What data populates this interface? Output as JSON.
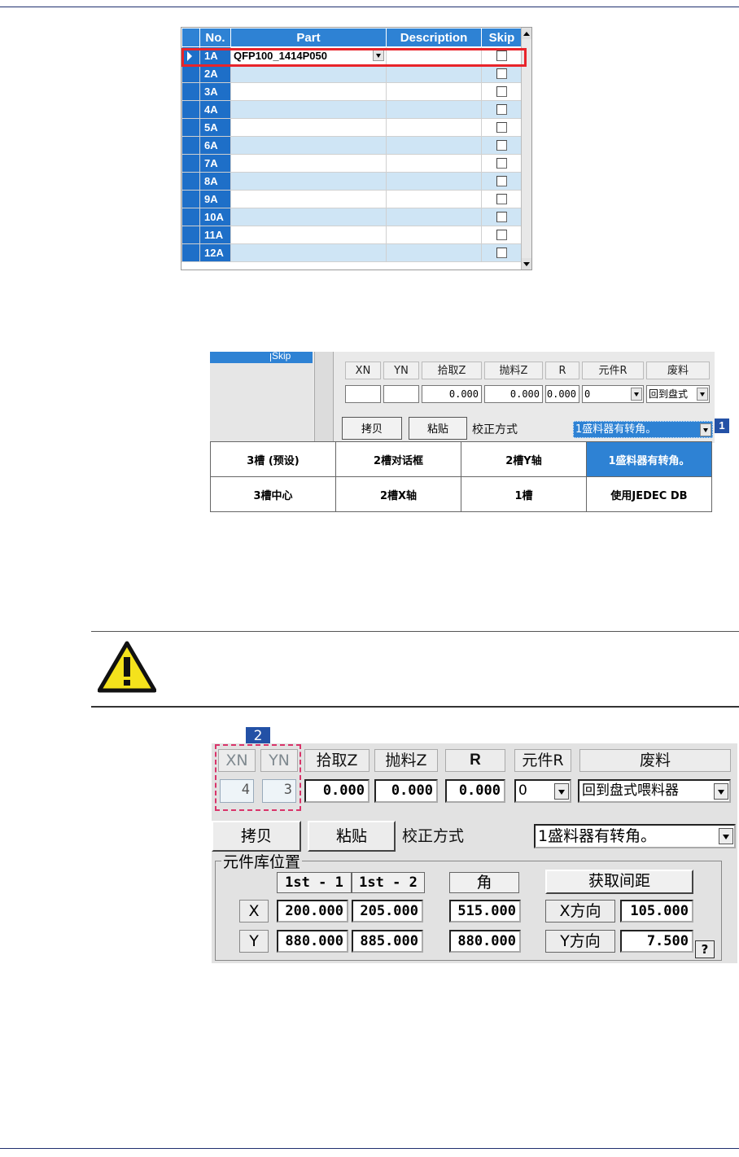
{
  "grid": {
    "headers": {
      "no": "No.",
      "part": "Part",
      "description": "Description",
      "skip": "Skip"
    },
    "rows": [
      {
        "no": "1A",
        "part": "QFP100_1414P050",
        "description": "",
        "skip": false
      },
      {
        "no": "2A",
        "part": "",
        "description": "",
        "skip": false
      },
      {
        "no": "3A",
        "part": "",
        "description": "",
        "skip": false
      },
      {
        "no": "4A",
        "part": "",
        "description": "",
        "skip": false
      },
      {
        "no": "5A",
        "part": "",
        "description": "",
        "skip": false
      },
      {
        "no": "6A",
        "part": "",
        "description": "",
        "skip": false
      },
      {
        "no": "7A",
        "part": "",
        "description": "",
        "skip": false
      },
      {
        "no": "8A",
        "part": "",
        "description": "",
        "skip": false
      },
      {
        "no": "9A",
        "part": "",
        "description": "",
        "skip": false
      },
      {
        "no": "10A",
        "part": "",
        "description": "",
        "skip": false
      },
      {
        "no": "11A",
        "part": "",
        "description": "",
        "skip": false
      },
      {
        "no": "12A",
        "part": "",
        "description": "",
        "skip": false
      }
    ]
  },
  "panel2": {
    "skip_label": "Skip",
    "headers": [
      "XN",
      "YN",
      "拾取Z",
      "抛料Z",
      "R",
      "元件R",
      "废料"
    ],
    "values": {
      "xn": "",
      "yn": "",
      "pick_z": "0.000",
      "throw_z": "0.000",
      "r": "0.000",
      "part_r": "0",
      "waste": "回到盘式"
    },
    "copy_label": "拷贝",
    "paste_label": "粘贴",
    "calib_label": "校正方式",
    "calib_value": "1盛料器有转角。",
    "badge": "1",
    "options": [
      [
        "3槽 (预设)",
        "2槽对话框",
        "2槽Y轴",
        "1盛料器有转角。"
      ],
      [
        "3槽中心",
        "2槽X轴",
        "1槽",
        "使用JEDEC DB"
      ]
    ]
  },
  "panel3": {
    "badge": "2",
    "headers": [
      "XN",
      "YN",
      "拾取Z",
      "抛料Z",
      "R",
      "元件R",
      "废料"
    ],
    "values": {
      "xn": "4",
      "yn": "3",
      "pick_z": "0.000",
      "throw_z": "0.000",
      "r": "0.000",
      "part_r": "0",
      "waste": "回到盘式喂料器"
    },
    "copy_label": "拷贝",
    "paste_label": "粘贴",
    "calib_label": "校正方式",
    "calib_value": "1盛料器有转角。",
    "group_title": "元件库位置",
    "col_1st1": "1st - 1",
    "col_1st2": "1st  - 2",
    "col_corner": "角",
    "get_pitch": "获取间距",
    "row_x": {
      "label": "X",
      "v1": "200.000",
      "v2": "205.000",
      "corner": "515.000",
      "dir": "X方向",
      "pitch": "105.000"
    },
    "row_y": {
      "label": "Y",
      "v1": "880.000",
      "v2": "885.000",
      "corner": "880.000",
      "dir": "Y方向",
      "pitch": "7.500"
    },
    "help": "?"
  },
  "colors": {
    "header_blue": "#2e82d4",
    "row_alt": "#cfe5f5",
    "highlight_red": "#e8242a",
    "badge_blue": "#2351a6",
    "dash_pink": "#d9346a"
  }
}
